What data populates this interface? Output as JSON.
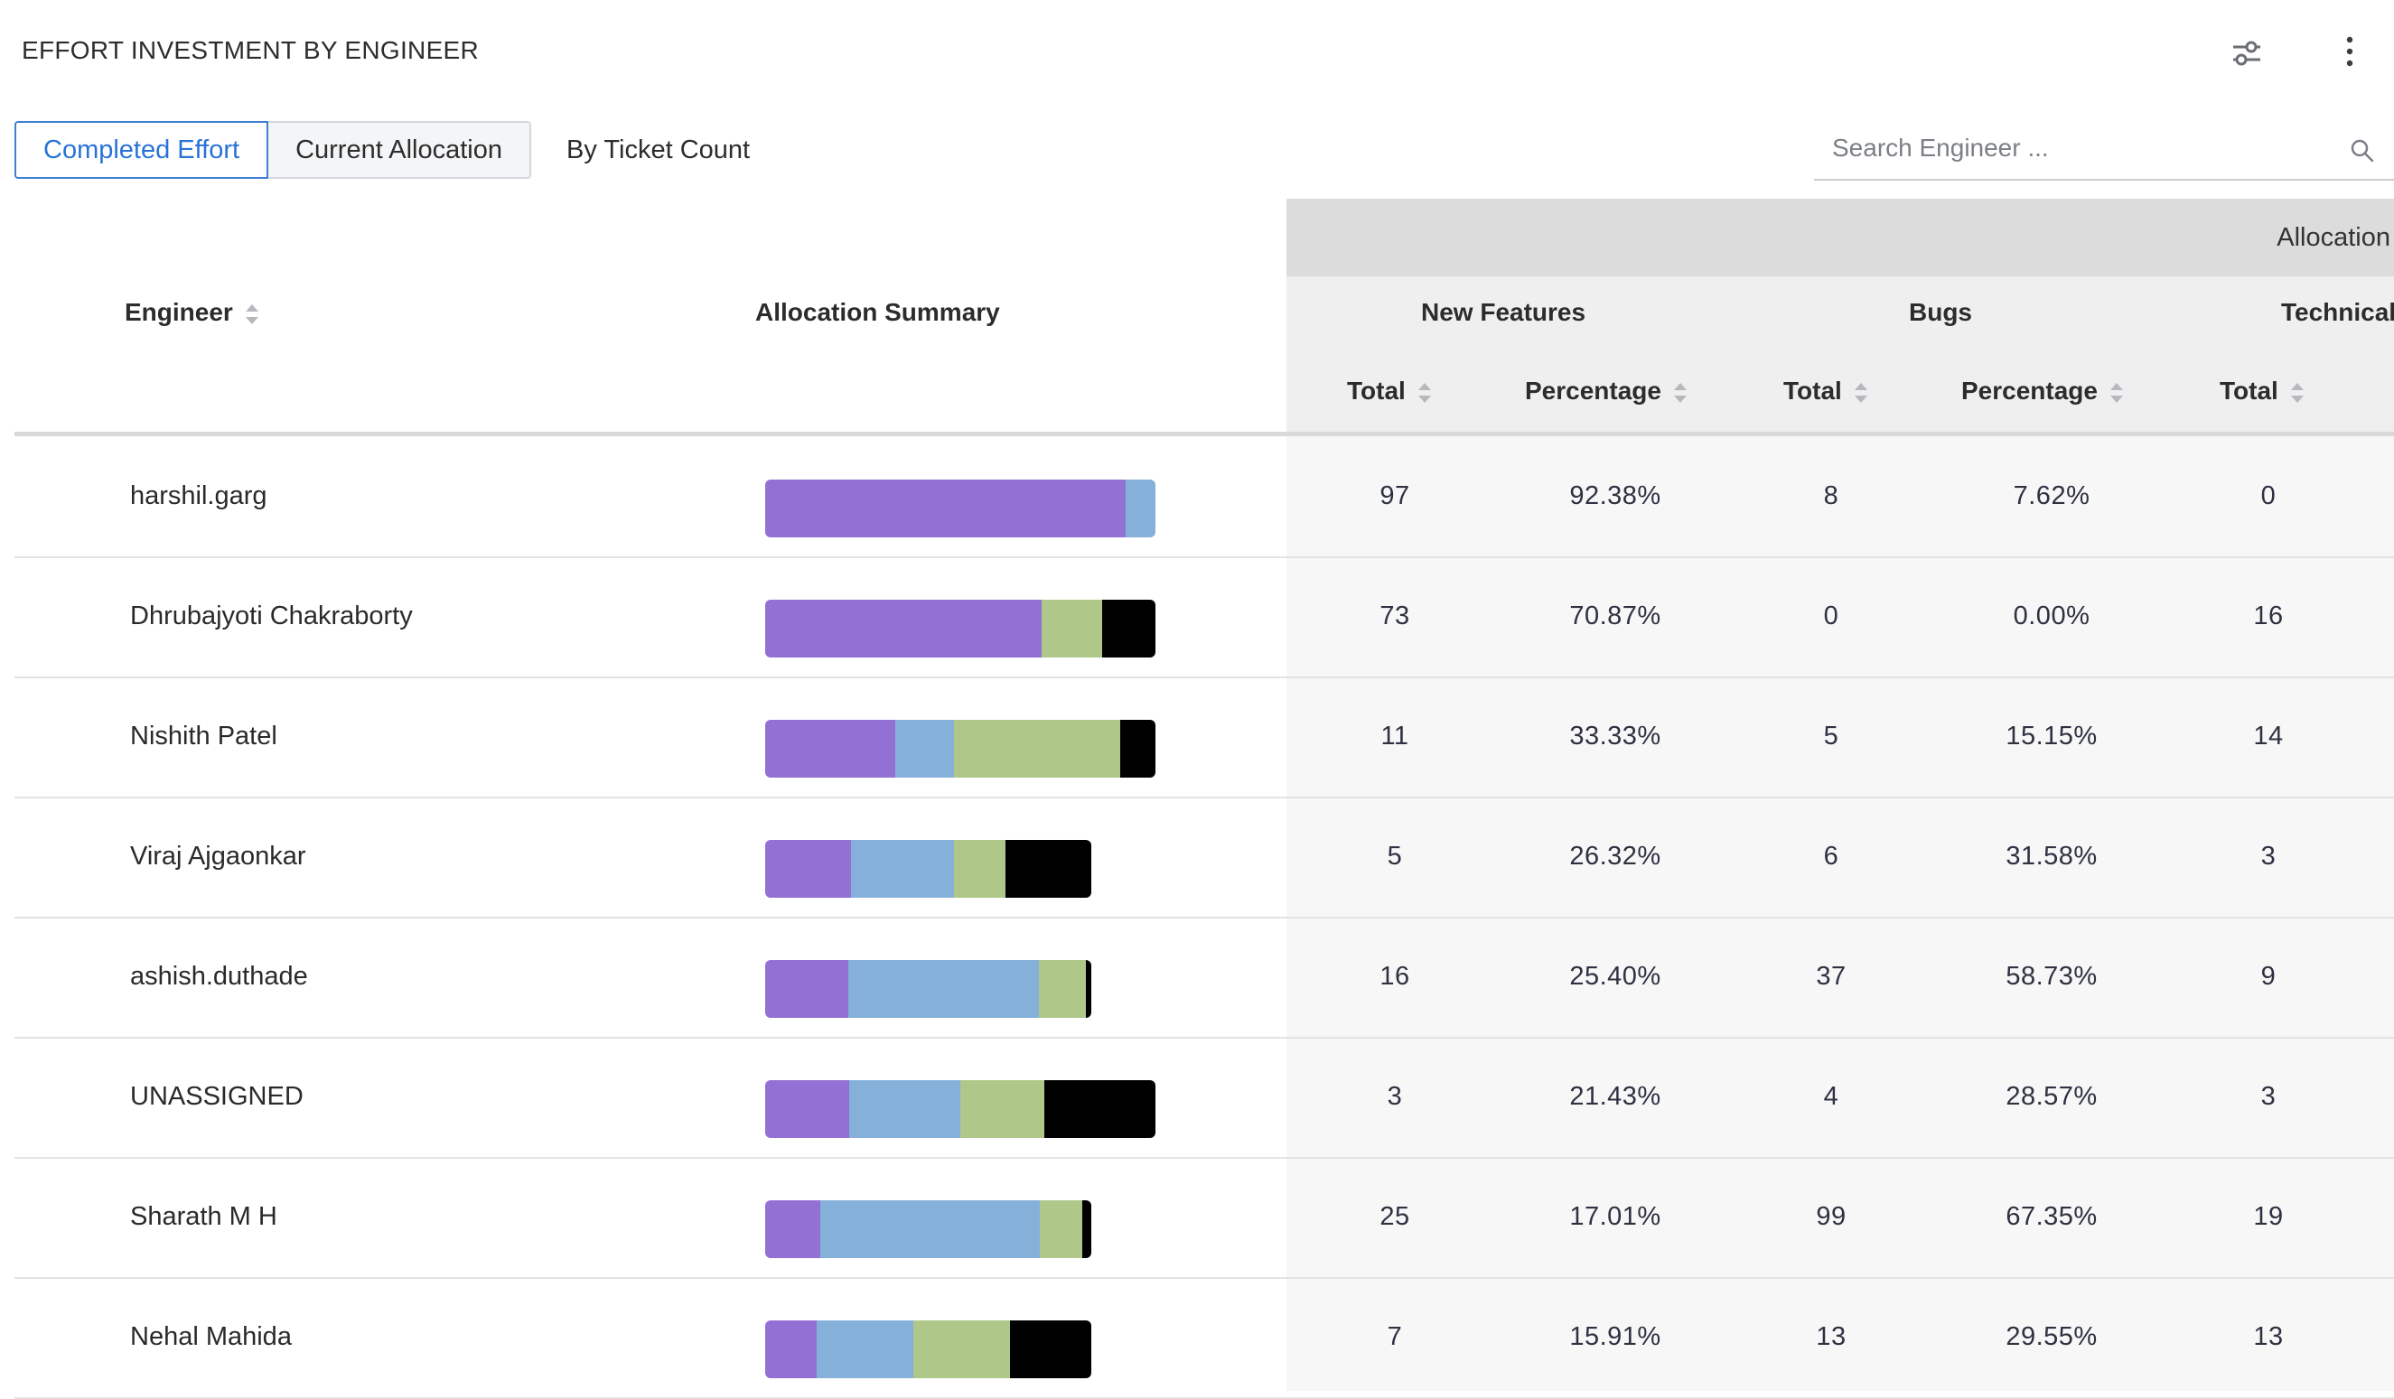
{
  "title": "EFFORT INVESTMENT BY ENGINEER",
  "header_icons": {
    "settings": "sliders-icon",
    "more": "more-vertical-icon"
  },
  "tabs": [
    {
      "label": "Completed Effort",
      "active": true
    },
    {
      "label": "Current Allocation",
      "active": false
    }
  ],
  "ticket_count_label": "By Ticket Count",
  "search": {
    "placeholder": "Search Engineer ...",
    "icon": "search-icon"
  },
  "colors": {
    "new_features": "#9370d4",
    "bugs": "#85b0d9",
    "technical": "#afc88a",
    "other": "#000000",
    "accent": "#2a73d6"
  },
  "table": {
    "group_header": "Allocation",
    "columns": {
      "engineer": "Engineer",
      "summary": "Allocation Summary",
      "new_features": "New Features",
      "bugs": "Bugs",
      "technical": "Technical",
      "total": "Total",
      "percentage": "Percentage"
    },
    "rows": [
      {
        "engineer": "harshil.garg",
        "nf_total": "97",
        "nf_pct": "92.38%",
        "bug_total": "8",
        "bug_pct": "7.62%",
        "tech_total": "0",
        "summary": [
          92.38,
          7.62,
          0,
          0
        ],
        "summary_scale": 1.0
      },
      {
        "engineer": "Dhrubajyoti Chakraborty",
        "nf_total": "73",
        "nf_pct": "70.87%",
        "bug_total": "0",
        "bug_pct": "0.00%",
        "tech_total": "16",
        "summary": [
          70.87,
          0,
          15.53,
          13.6
        ],
        "summary_scale": 1.0
      },
      {
        "engineer": "Nishith Patel",
        "nf_total": "11",
        "nf_pct": "33.33%",
        "bug_total": "5",
        "bug_pct": "15.15%",
        "tech_total": "14",
        "summary": [
          33.33,
          15.15,
          42.42,
          9.1
        ],
        "summary_scale": 1.0
      },
      {
        "engineer": "Viraj Ajgaonkar",
        "nf_total": "5",
        "nf_pct": "26.32%",
        "bug_total": "6",
        "bug_pct": "31.58%",
        "tech_total": "3",
        "summary": [
          26.32,
          31.58,
          15.79,
          26.31
        ],
        "summary_scale": 0.835
      },
      {
        "engineer": "ashish.duthade",
        "nf_total": "16",
        "nf_pct": "25.40%",
        "bug_total": "37",
        "bug_pct": "58.73%",
        "tech_total": "9",
        "summary": [
          25.4,
          58.73,
          14.29,
          1.58
        ],
        "summary_scale": 0.835
      },
      {
        "engineer": "UNASSIGNED",
        "nf_total": "3",
        "nf_pct": "21.43%",
        "bug_total": "4",
        "bug_pct": "28.57%",
        "tech_total": "3",
        "summary": [
          21.43,
          28.57,
          21.43,
          28.57
        ],
        "summary_scale": 1.0
      },
      {
        "engineer": "Sharath M H",
        "nf_total": "25",
        "nf_pct": "17.01%",
        "bug_total": "99",
        "bug_pct": "67.35%",
        "tech_total": "19",
        "summary": [
          17.01,
          67.35,
          12.93,
          2.71
        ],
        "summary_scale": 0.835
      },
      {
        "engineer": "Nehal Mahida",
        "nf_total": "7",
        "nf_pct": "15.91%",
        "bug_total": "13",
        "bug_pct": "29.55%",
        "tech_total": "13",
        "summary": [
          15.91,
          29.55,
          29.55,
          24.99
        ],
        "summary_scale": 0.835
      }
    ]
  }
}
